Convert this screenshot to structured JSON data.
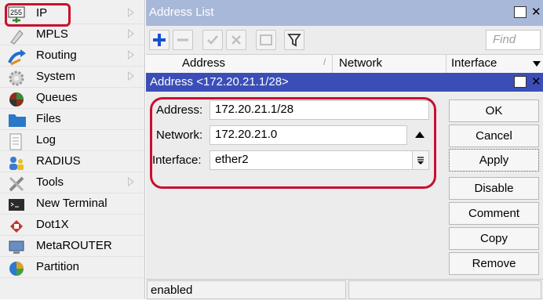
{
  "sidebar": {
    "items": [
      {
        "label": "IP",
        "icon": "ip-icon",
        "has_submenu": true
      },
      {
        "label": "MPLS",
        "icon": "mpls-icon",
        "has_submenu": true
      },
      {
        "label": "Routing",
        "icon": "routing-icon",
        "has_submenu": true
      },
      {
        "label": "System",
        "icon": "system-gear-icon",
        "has_submenu": true
      },
      {
        "label": "Queues",
        "icon": "queues-icon",
        "has_submenu": false
      },
      {
        "label": "Files",
        "icon": "folder-icon",
        "has_submenu": false
      },
      {
        "label": "Log",
        "icon": "log-icon",
        "has_submenu": false
      },
      {
        "label": "RADIUS",
        "icon": "radius-users-icon",
        "has_submenu": false
      },
      {
        "label": "Tools",
        "icon": "tools-icon",
        "has_submenu": true
      },
      {
        "label": "New Terminal",
        "icon": "terminal-icon",
        "has_submenu": false
      },
      {
        "label": "Dot1X",
        "icon": "dot1x-icon",
        "has_submenu": false
      },
      {
        "label": "MetaROUTER",
        "icon": "metarouter-icon",
        "has_submenu": false
      },
      {
        "label": "Partition",
        "icon": "partition-icon",
        "has_submenu": false
      }
    ],
    "ip_badge": "255"
  },
  "address_list": {
    "title": "Address List",
    "find_placeholder": "Find",
    "columns": [
      "Address",
      "Network",
      "Interface"
    ]
  },
  "dialog": {
    "title": "Address <172.20.21.1/28>",
    "address_label": "Address:",
    "address_value": "172.20.21.1/28",
    "network_label": "Network:",
    "network_value": "172.20.21.0",
    "interface_label": "Interface:",
    "interface_value": "ether2",
    "buttons": [
      "OK",
      "Cancel",
      "Apply",
      "Disable",
      "Comment",
      "Copy",
      "Remove"
    ],
    "status": "enabled"
  },
  "colors": {
    "highlight": "#c8102e",
    "dialog_title_bg": "#3b4eb8",
    "list_title_bg": "#a8b8d8"
  }
}
